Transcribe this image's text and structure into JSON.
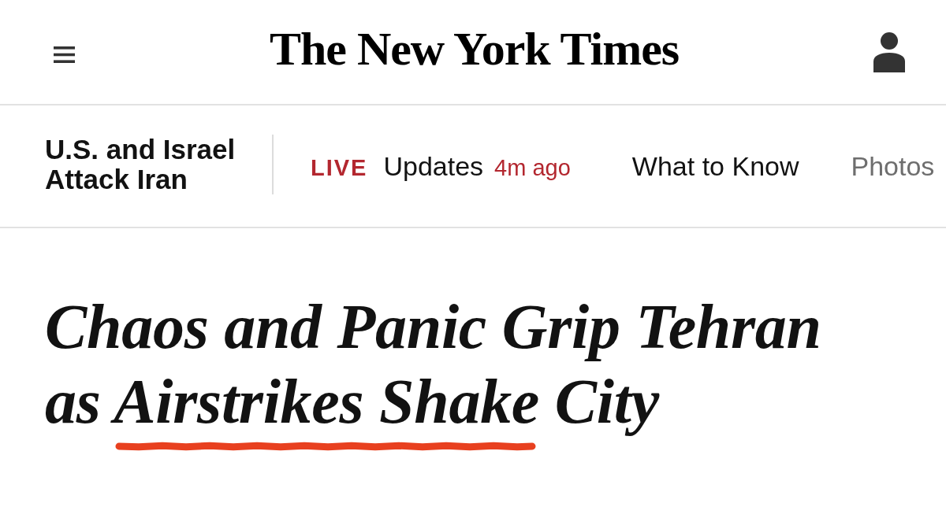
{
  "header": {
    "logo": "The New York Times"
  },
  "section_bar": {
    "title": "U.S. and Israel Attack Iran",
    "links": [
      {
        "kind": "live",
        "badge": "LIVE",
        "label": "Updates",
        "time": "4m ago"
      },
      {
        "kind": "link",
        "label": "What to Know"
      },
      {
        "kind": "link",
        "label": "Photos"
      }
    ]
  },
  "headline": {
    "parts": [
      {
        "text": "Chaos and Panic Grip Tehran as ",
        "underlined": false
      },
      {
        "text": "Airstrikes Shake",
        "underlined": true
      },
      {
        "text": " City",
        "underlined": false
      }
    ]
  }
}
